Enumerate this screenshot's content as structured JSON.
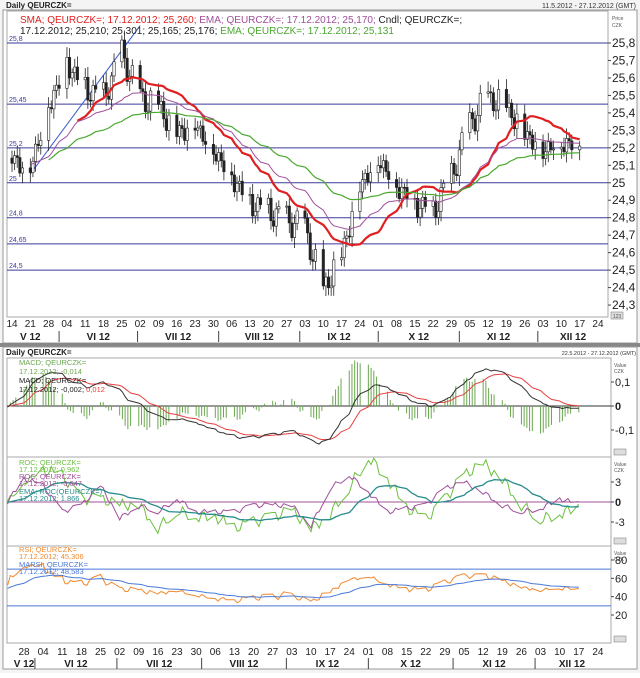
{
  "top_panel": {
    "title": "Daily QEURCZK=",
    "date_range": "11.5.2012 - 27.12.2012 (GMT)",
    "axis_caption": [
      "Price",
      "CZK"
    ],
    "legend": {
      "sma": "SMA; QEURCZK=; 17.12.2012; 25,260;",
      "ema1": " EMA; QEURCZK=; 17.12.2012; 25,170;",
      "cndl1": " Cndl; QEURCZK=;",
      "cndl2": "17.12.2012; 25,210; 25,301; 25,165; 25,176;",
      "ema2": " EMA; QEURCZK=; 17.12.2012; 25,131"
    },
    "y_ticks": [
      "25,8",
      "25,7",
      "25,6",
      "25,5",
      "25,4",
      "25,3",
      "25,2",
      "25,1",
      "25",
      "24,9",
      "24,8",
      "24,7",
      "24,6",
      "24,5",
      "24,4",
      "24,3"
    ],
    "hlines": [
      "25,8",
      "25,45",
      "25,2",
      "25",
      "24,8",
      "24,65",
      "24,5"
    ],
    "scale_button": "123"
  },
  "bottom_panel": {
    "title": "Daily QEURCZK=",
    "date_range": "22.5.2012 - 27.12.2012 (GMT)",
    "axis_caption": [
      "Value",
      "CZK"
    ],
    "macd_legend": [
      "MACD; QEURCZK=",
      "17.12.2012; -0,014",
      "MACD; QEURCZK=",
      "17.12.2012; -0,002;",
      " 0,012"
    ],
    "macd_ticks": [
      "0,1",
      "0",
      "-0,1"
    ],
    "roc_legend": [
      "ROC; QEURCZK=",
      "17.12.2012; 0,962",
      "ROC; QEURCZK=",
      "17.12.2012; -0,647",
      "EMA; ROC(QEURCZK=)",
      "17.12.2012; 1,866"
    ],
    "roc_ticks": [
      "3",
      "0",
      "-3"
    ],
    "rsi_legend": [
      "RSI; QEURCZK=",
      "17.12.2012; 45,306",
      "MARSI; QEURCZK=",
      "17.12.2012; 48,583"
    ],
    "rsi_ticks": [
      "80",
      "60",
      "40",
      "20"
    ],
    "scale_button": "123"
  },
  "x_axis": {
    "top_week_labels": [
      "14",
      "21",
      "28",
      "04",
      "11",
      "18",
      "25",
      "02",
      "09",
      "16",
      "23",
      "30",
      "06",
      "13",
      "20",
      "27",
      "03",
      "10",
      "17",
      "24",
      "01",
      "08",
      "15",
      "22",
      "29",
      "05",
      "12",
      "19",
      "26",
      "03",
      "10",
      "17",
      "24"
    ],
    "bottom_week_labels": [
      "28",
      "04",
      "11",
      "18",
      "25",
      "02",
      "09",
      "16",
      "23",
      "30",
      "06",
      "13",
      "20",
      "27",
      "03",
      "10",
      "17",
      "24",
      "01",
      "08",
      "15",
      "22",
      "29",
      "05",
      "12",
      "19",
      "26",
      "03",
      "10",
      "17",
      "24"
    ],
    "months": [
      "V 12",
      "VI 12",
      "VII 12",
      "VIII 12",
      "IX 12",
      "X 12",
      "XI 12",
      "XII 12"
    ]
  },
  "colors": {
    "sma": "#e02020",
    "ema_purple": "#a0509a",
    "ema_green": "#4aa830",
    "hline": "#3a3a9a",
    "macd_signal": "#e84040",
    "macd_hist": "#6aa84f",
    "roc_green": "#6cc040",
    "roc_purple": "#a0509a",
    "roc_ema": "#2a8c8c",
    "rsi": "#f08a30",
    "marsi": "#4a78d8",
    "rsi_bands": "#4a78d8"
  },
  "chart_data": {
    "type": "candlestick",
    "title": "Daily QEURCZK=",
    "ylabel": "Price CZK",
    "ylim": [
      24.3,
      25.8
    ],
    "weekly_closes": {
      "week_starts": [
        "14.5",
        "21.5",
        "28.5",
        "4.6",
        "11.6",
        "18.6",
        "25.6",
        "2.7",
        "9.7",
        "16.7",
        "23.7",
        "30.7",
        "6.8",
        "13.8",
        "20.8",
        "27.8",
        "3.9",
        "10.9",
        "17.9",
        "24.9",
        "1.10",
        "8.10",
        "15.10",
        "22.10",
        "29.10",
        "5.11",
        "12.11",
        "19.11",
        "26.11",
        "3.12",
        "10.12",
        "17.12"
      ],
      "values": [
        25.15,
        25.1,
        25.45,
        25.7,
        25.55,
        25.5,
        25.75,
        25.5,
        25.45,
        25.3,
        25.35,
        25.2,
        25.05,
        24.9,
        24.85,
        24.8,
        24.75,
        24.4,
        24.6,
        25.0,
        25.15,
        25.0,
        24.9,
        24.85,
        25.05,
        25.35,
        25.5,
        25.45,
        25.3,
        25.2,
        25.25,
        25.21
      ]
    },
    "trendline": {
      "from": [
        "21.5",
        25.05
      ],
      "to": [
        "2.7",
        25.9
      ]
    },
    "indicators": [
      "SMA",
      "EMA",
      "EMA",
      "MACD",
      "ROC",
      "RSI",
      "MARSI"
    ],
    "macd_ylim": [
      -0.15,
      0.15
    ],
    "roc_ylim": [
      -6,
      6
    ],
    "rsi_ylim": [
      10,
      90
    ],
    "rsi_bands": [
      70,
      30
    ]
  }
}
